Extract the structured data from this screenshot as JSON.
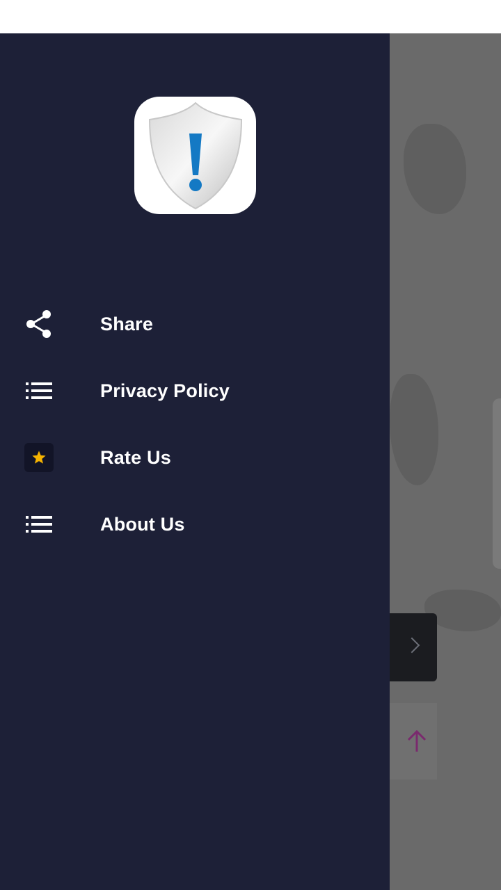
{
  "colors": {
    "drawer_bg": "#1d2037",
    "scrim": "#6a6a6a",
    "text": "#ffffff",
    "star": "#f5b301",
    "logo_accent": "#1479c4"
  },
  "app": {
    "logo_icon": "shield-exclamation-icon"
  },
  "menu": {
    "items": [
      {
        "label": "Share",
        "icon": "share-icon"
      },
      {
        "label": "Privacy Policy",
        "icon": "list-icon"
      },
      {
        "label": "Rate Us",
        "icon": "star-icon"
      },
      {
        "label": "About Us",
        "icon": "list-icon"
      }
    ]
  },
  "background": {
    "next_icon": "chevron-right-icon",
    "scroll_top_icon": "arrow-up-icon"
  }
}
